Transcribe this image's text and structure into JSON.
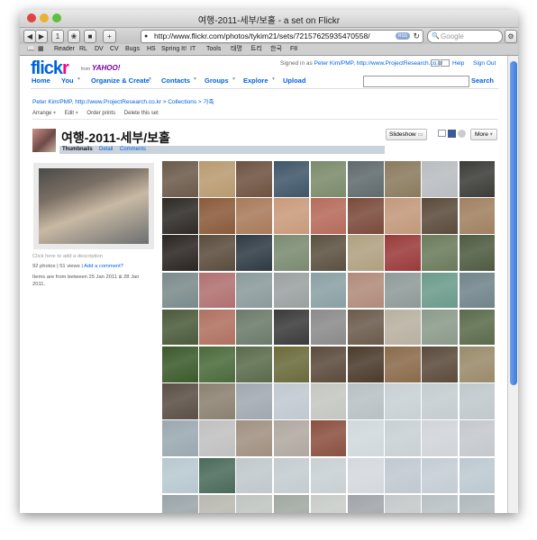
{
  "window": {
    "title": "여행-2011-세부/보홀 - a set on Flickr"
  },
  "toolbar": {
    "url": "http://www.flickr.com/photos/tykim21/sets/72157625935470558/",
    "rss_label": "RSS",
    "search_placeholder": "Google",
    "icons": [
      "back-icon",
      "forward-icon",
      "1password-icon",
      "reader-icon",
      "stop-icon",
      "add-bookmark-icon",
      "reload-icon",
      "settings-icon"
    ]
  },
  "bookmarks": [
    "Reader",
    "RL",
    "DV",
    "CV",
    "Bugs",
    "HS",
    "Spring It!",
    "IT",
    "Tools",
    "태명",
    "트리",
    "한국",
    "F8"
  ],
  "flickr": {
    "logo_flick": "flick",
    "logo_r": "r",
    "logo_from": "from",
    "logo_yahoo": "YAHOO!",
    "signed_in_prefix": "Signed in as",
    "signed_in_user": "Peter Kim/PMP, http://www.ProjectResearch.co.kr",
    "help": "Help",
    "sign_out": "Sign Out",
    "search_button": "Search",
    "nav": [
      "Home",
      "You",
      "Organize & Create",
      "Contacts",
      "Groups",
      "Explore",
      "Upload"
    ]
  },
  "breadcrumb": "Peter Kim/PMP, http://www.ProjectResearch.co.kr > Collections > 가족",
  "actions": [
    "Arrange",
    "Edit",
    "Order prints",
    "Delete this set"
  ],
  "set": {
    "title": "여행-2011-세부/보홀",
    "tabs": [
      "Thumbnails",
      "Detail",
      "Comments"
    ],
    "slideshow": "Slideshow",
    "more": "More"
  },
  "sidebar": {
    "description_placeholder": "Click here to add a description",
    "photos_views": "92 photos | 51 views |",
    "add_comment": "Add a comment?",
    "date_range_1": "Items are from between 25 Jan 2011 & 28 Jan",
    "date_range_2": "2011."
  },
  "photos": [
    "#6b5a4a",
    "#b89a70",
    "#6e5240",
    "#3f5668",
    "#7b8a6a",
    "#5f6a6c",
    "#8a7a5e",
    "#b9bcc0",
    "#3b3b38",
    "#2d2a26",
    "#8a5a3a",
    "#a87a5a",
    "#c99a7a",
    "#b66a5a",
    "#7a4a3a",
    "#c2987a",
    "#5a4a3a",
    "#a08060",
    "#2a2422",
    "#5a4c3c",
    "#2e3a44",
    "#7a8a70",
    "#5a5040",
    "#b0a080",
    "#9a3a3a",
    "#6a7a5a",
    "#4e5a40",
    "#7a8a8a",
    "#b07070",
    "#8a9a9a",
    "#9aa0a0",
    "#8aa0a4",
    "#b08a7a",
    "#8e9a98",
    "#6a9a8a",
    "#70848a",
    "#4a5a3a",
    "#b07060",
    "#6a7a6a",
    "#3a3a3a",
    "#8a8a8a",
    "#6a5a4a",
    "#b8b0a0",
    "#8a9a8a",
    "#5a6a4a",
    "#3a5a2a",
    "#4a6a3a",
    "#5a6a4a",
    "#6a6a3a",
    "#5a4a3a",
    "#4a3a2a",
    "#8a6a4a",
    "#5a4a3a",
    "#9a8a6a",
    "#5a4e44",
    "#8a8070",
    "#a0a8b0",
    "#c0c8d0",
    "#c4c6c0",
    "#b8c0c4",
    "#c8d0d4",
    "#c4ccd0",
    "#c0c8cc",
    "#9aa8b0",
    "#c0c0c0",
    "#a09080",
    "#b0a8a0",
    "#8a5040",
    "#d0d8dc",
    "#c8d0d4",
    "#d0d4d8",
    "#c4c8cc",
    "#b8c8d0",
    "#4a6a5a",
    "#c0c8cc",
    "#c4ccd0",
    "#c8d0d4",
    "#d4d8dc",
    "#c0c8d0",
    "#c4ccd4",
    "#bcc8d0",
    "#9aa4a8",
    "#b8b8b0",
    "#c0c4c0",
    "#a0a8a0",
    "#c8ccc8",
    "#a0a4a8",
    "#c4c8c8",
    "#b8c0c4",
    "#b0b8bc"
  ]
}
